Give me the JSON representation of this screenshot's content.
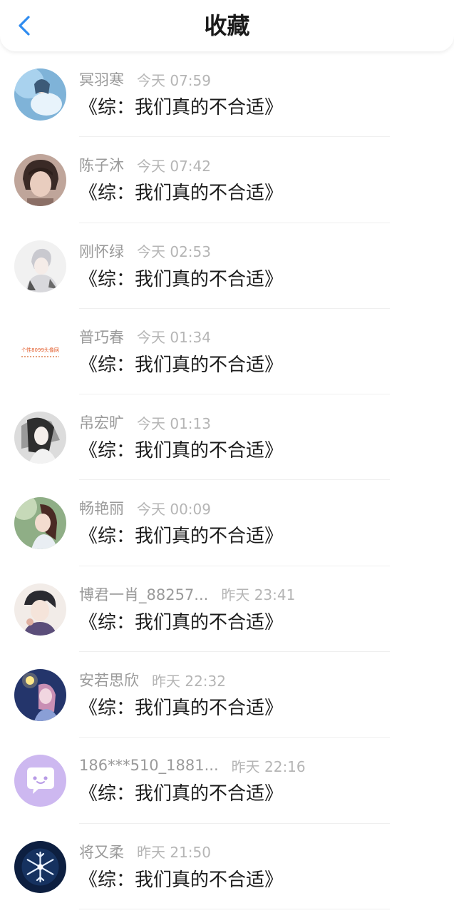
{
  "header": {
    "title": "收藏",
    "back_icon": "chevron-left-icon",
    "accent": "#2f8cf0"
  },
  "favorites": [
    {
      "name": "冥羽寒",
      "time": "今天 07:59",
      "message": "《综：我们真的不合适》"
    },
    {
      "name": "陈子沐",
      "time": "今天 07:42",
      "message": "《综：我们真的不合适》"
    },
    {
      "name": "刚怀绿",
      "time": "今天 02:53",
      "message": "《综：我们真的不合适》"
    },
    {
      "name": "普巧春",
      "time": "今天 01:34",
      "message": "《综：我们真的不合适》"
    },
    {
      "name": "帛宏旷",
      "time": "今天 01:13",
      "message": "《综：我们真的不合适》"
    },
    {
      "name": "畅艳丽",
      "time": "今天 00:09",
      "message": "《综：我们真的不合适》"
    },
    {
      "name": "博君一肖_88257...",
      "time": "昨天 23:41",
      "message": "《综：我们真的不合适》"
    },
    {
      "name": "安若思欣",
      "time": "昨天 22:32",
      "message": "《综：我们真的不合适》"
    },
    {
      "name": "186***510_1881...",
      "time": "昨天 22:16",
      "message": "《综：我们真的不合适》"
    },
    {
      "name": "将又柔",
      "time": "昨天 21:50",
      "message": "《综：我们真的不合适》"
    }
  ],
  "avatar_watermark": "个性8099头像网"
}
